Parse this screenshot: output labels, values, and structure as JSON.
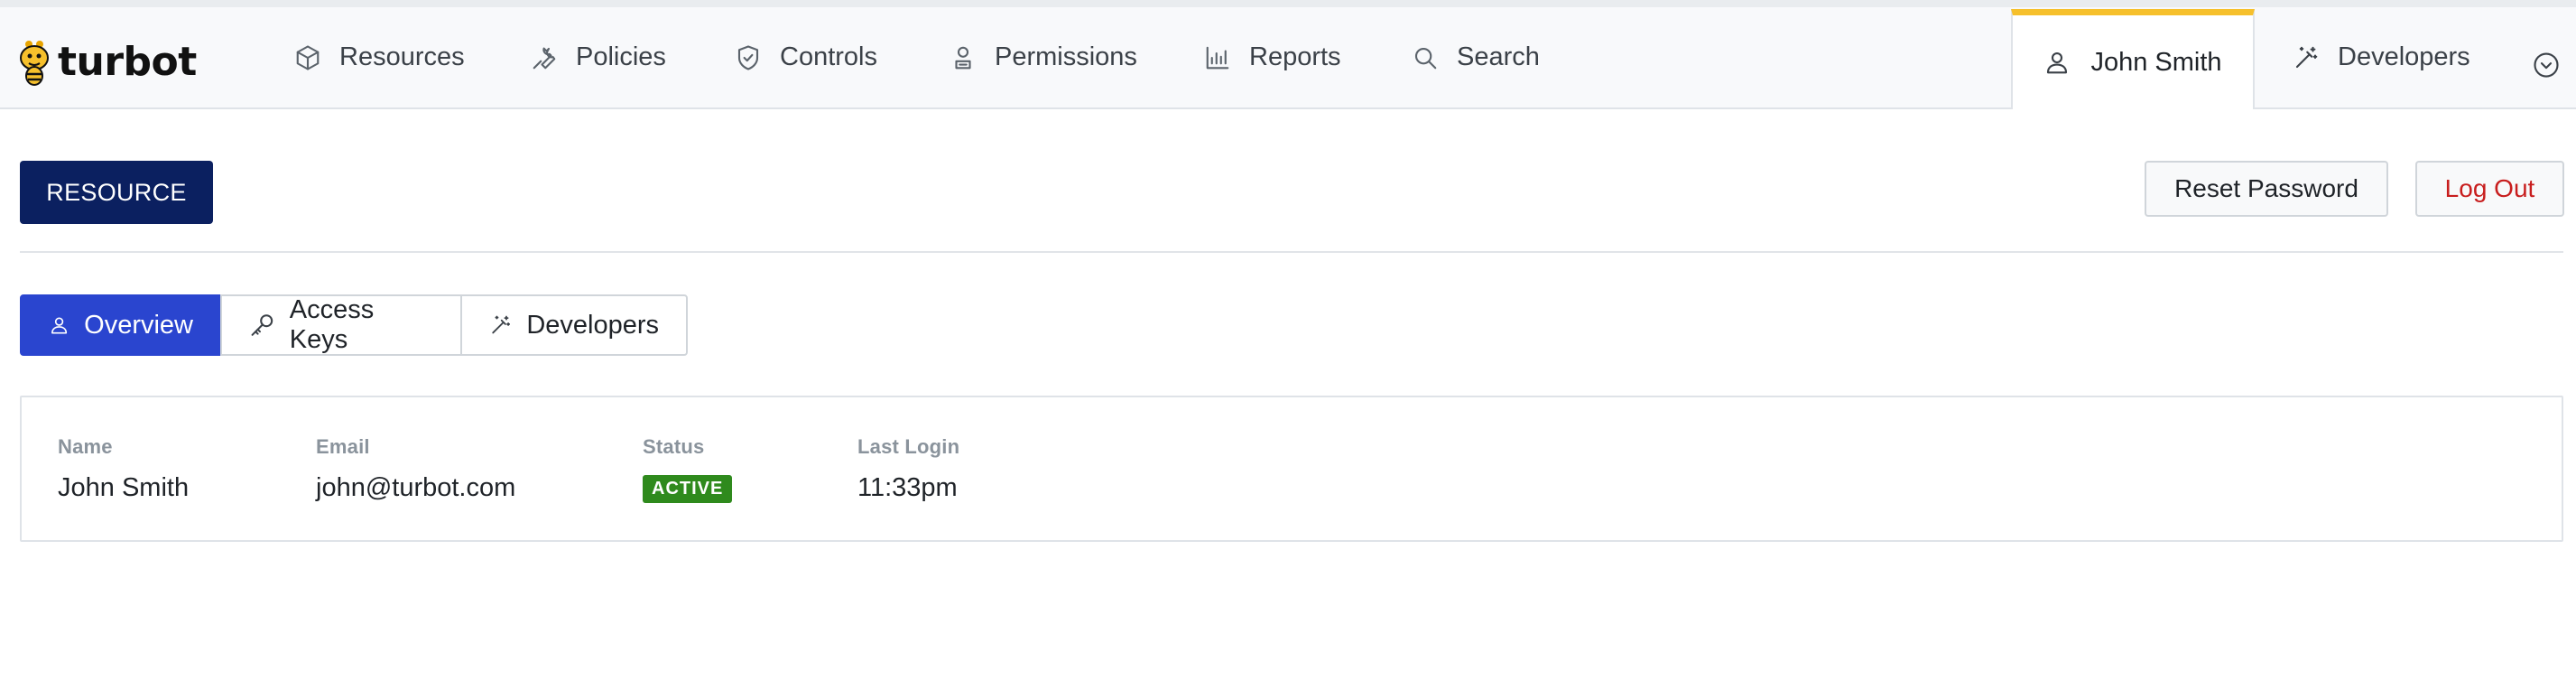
{
  "brand": {
    "logo_text": "turbot"
  },
  "nav": {
    "items": [
      {
        "label": "Resources",
        "icon": "cube-icon"
      },
      {
        "label": "Policies",
        "icon": "wrench-icon"
      },
      {
        "label": "Controls",
        "icon": "shield-check-icon"
      },
      {
        "label": "Permissions",
        "icon": "user-badge-icon"
      },
      {
        "label": "Reports",
        "icon": "bar-chart-icon"
      },
      {
        "label": "Search",
        "icon": "search-icon"
      }
    ],
    "user_tab": {
      "label": "John Smith",
      "icon": "user-icon"
    },
    "developers_tab": {
      "label": "Developers",
      "icon": "magic-wand-icon"
    },
    "more_icon": "chevron-down-circle-icon"
  },
  "header": {
    "resource_badge": "RESOURCE",
    "reset_password_label": "Reset Password",
    "logout_label": "Log Out"
  },
  "tabs": [
    {
      "label": "Overview",
      "icon": "user-icon",
      "active": true
    },
    {
      "label": "Access Keys",
      "icon": "key-icon",
      "active": false
    },
    {
      "label": "Developers",
      "icon": "magic-wand-icon",
      "active": false
    }
  ],
  "details": {
    "name_label": "Name",
    "name_value": "John Smith",
    "email_label": "Email",
    "email_value": "john@turbot.com",
    "status_label": "Status",
    "status_value": "ACTIVE",
    "last_login_label": "Last Login",
    "last_login_value": "11:33pm"
  },
  "colors": {
    "accent_yellow": "#f6c02c",
    "resource_badge": "#0b2060",
    "active_tab": "#2a45cf",
    "status_active": "#2f8a1d",
    "logout_red": "#c81e1e"
  }
}
